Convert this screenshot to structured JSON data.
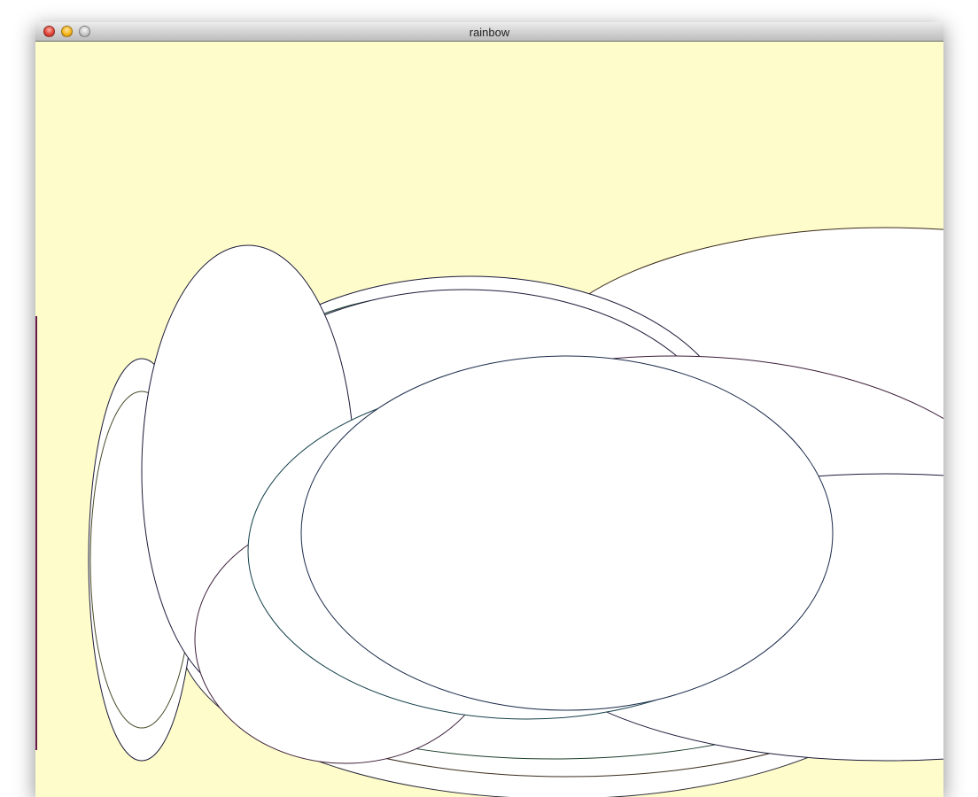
{
  "window": {
    "title": "rainbow",
    "background_color": "#fffccb"
  },
  "controls": {
    "close_icon": "close-icon",
    "minimize_icon": "minimize-icon",
    "zoom_icon": "zoom-icon"
  },
  "sketch": {
    "shape": "ellipse",
    "fill": "#ffffff",
    "stroke_colors": [
      "#3a2a1a",
      "#1b1b3a",
      "#14404a",
      "#3d1e3a",
      "#1a3d2a"
    ]
  }
}
